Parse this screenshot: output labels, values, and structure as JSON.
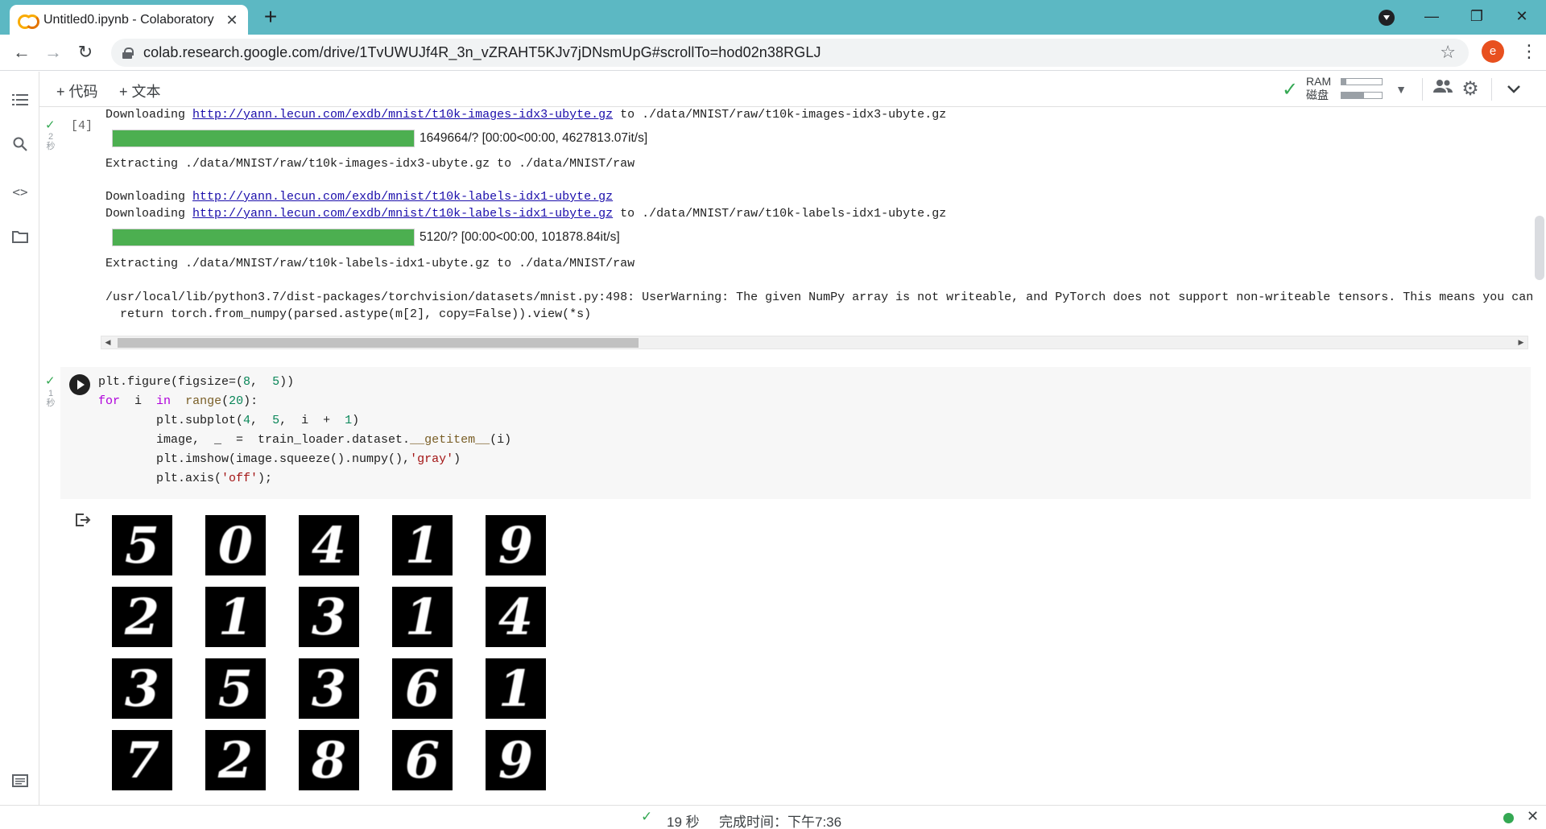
{
  "browser": {
    "tab_title": "Untitled0.ipynb - Colaboratory",
    "tab_close": "✕",
    "new_tab": "+",
    "url": "colab.research.google.com/drive/1TvUWUJf4R_3n_vZRAHT5KJv7jDNsmUpG#scrollTo=hod02n38RGLJ",
    "avatar_letter": "e",
    "window_controls": {
      "minimize": "—",
      "restore": "❐",
      "close": "✕"
    }
  },
  "colab": {
    "add_code": "+ 代码",
    "add_text": "+ 文本",
    "ram_label": "RAM",
    "disk_label": "磁盘",
    "ram_fraction": 0.12,
    "disk_fraction": 0.55
  },
  "output_cell": {
    "exec_count": "[4]",
    "exec_time": "2\n秒",
    "lines": {
      "dl1_prefix": "Downloading ",
      "dl1_link": "http://yann.lecun.com/exdb/mnist/t10k-images-idx3-ubyte.gz",
      "dl1_suffix": " to ./data/MNIST/raw/t10k-images-idx3-ubyte.gz",
      "progress1_text": "1649664/? [00:00<00:00, 4627813.07it/s]",
      "extract1": "Extracting ./data/MNIST/raw/t10k-images-idx3-ubyte.gz to ./data/MNIST/raw",
      "dl2_prefix": "Downloading ",
      "dl2_link": "http://yann.lecun.com/exdb/mnist/t10k-labels-idx1-ubyte.gz",
      "dl3_prefix": "Downloading ",
      "dl3_link": "http://yann.lecun.com/exdb/mnist/t10k-labels-idx1-ubyte.gz",
      "dl3_suffix": " to ./data/MNIST/raw/t10k-labels-idx1-ubyte.gz",
      "progress2_text": "5120/? [00:00<00:00, 101878.84it/s]",
      "extract2": "Extracting ./data/MNIST/raw/t10k-labels-idx1-ubyte.gz to ./data/MNIST/raw",
      "warning1": "/usr/local/lib/python3.7/dist-packages/torchvision/datasets/mnist.py:498: UserWarning: The given NumPy array is not writeable, and PyTorch does not support non-writeable tensors. This means you can",
      "warning2": "  return torch.from_numpy(parsed.astype(m[2], copy=False)).view(*s)"
    },
    "progress1_fraction": 1.0,
    "progress2_fraction": 1.0
  },
  "code_cell": {
    "exec_time": "1\n秒",
    "code": {
      "l1_a": "plt.figure(figsize=(",
      "l1_n1": "8",
      "l1_b": ",  ",
      "l1_n2": "5",
      "l1_c": "))",
      "l2_kw1": "for",
      "l2_a": "  i  ",
      "l2_kw2": "in",
      "l2_b": "  ",
      "l2_fn": "range",
      "l2_c": "(",
      "l2_n": "20",
      "l2_d": "):",
      "l3_a": "        plt.subplot(",
      "l3_n1": "4",
      "l3_b": ",  ",
      "l3_n2": "5",
      "l3_c": ",  i  +  ",
      "l3_n3": "1",
      "l3_d": ")",
      "l4_a": "        image,  _  =  train_loader.dataset.",
      "l4_dunder": "__getitem__",
      "l4_b": "(i)",
      "l5_a": "        plt.imshow(image.squeeze().numpy(),",
      "l5_str": "'gray'",
      "l5_b": ")",
      "l6_a": "        plt.axis(",
      "l6_str": "'off'",
      "l6_b": ");"
    }
  },
  "digit_grid": [
    "5",
    "0",
    "4",
    "1",
    "9",
    "2",
    "1",
    "3",
    "1",
    "4",
    "3",
    "5",
    "3",
    "6",
    "1",
    "7",
    "2",
    "8",
    "6",
    "9"
  ],
  "status": {
    "duration": "19 秒",
    "completed": "完成时间：下午7:36"
  }
}
